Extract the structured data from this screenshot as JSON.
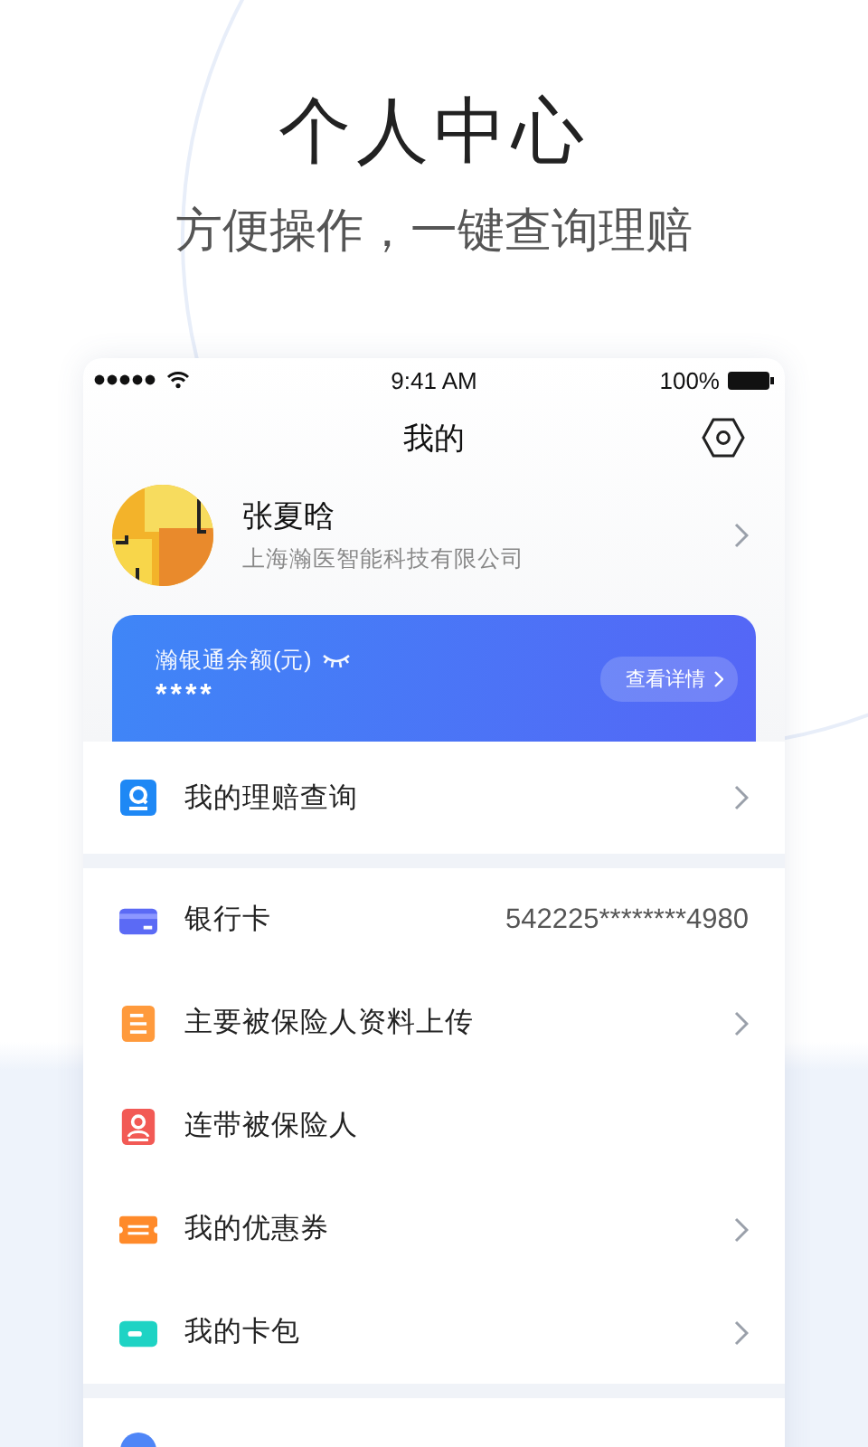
{
  "headline": "个人中心",
  "subtitle": "方便操作，一键查询理赔",
  "status_bar": {
    "time": "9:41 AM",
    "battery": "100%"
  },
  "nav": {
    "title": "我的"
  },
  "profile": {
    "name": "张夏晗",
    "company": "上海瀚医智能科技有限公司"
  },
  "balance_card": {
    "label": "瀚银通余额(元)",
    "amount": "****",
    "balance_visible": false,
    "button": "查看详情"
  },
  "groups": [
    {
      "items": [
        {
          "kind": "search",
          "label": "我的理赔查询",
          "chevron": true
        }
      ]
    },
    {
      "items": [
        {
          "kind": "card",
          "label": "银行卡",
          "value": "542225********4980",
          "chevron": false
        },
        {
          "kind": "document",
          "label": "主要被保险人资料上传",
          "chevron": true
        },
        {
          "kind": "person",
          "label": "连带被保险人",
          "chevron": false
        },
        {
          "kind": "coupon",
          "label": "我的优惠券",
          "chevron": true
        },
        {
          "kind": "wallet",
          "label": "我的卡包",
          "chevron": true
        }
      ]
    },
    {
      "items": [
        {
          "kind": "round"
        }
      ]
    }
  ]
}
